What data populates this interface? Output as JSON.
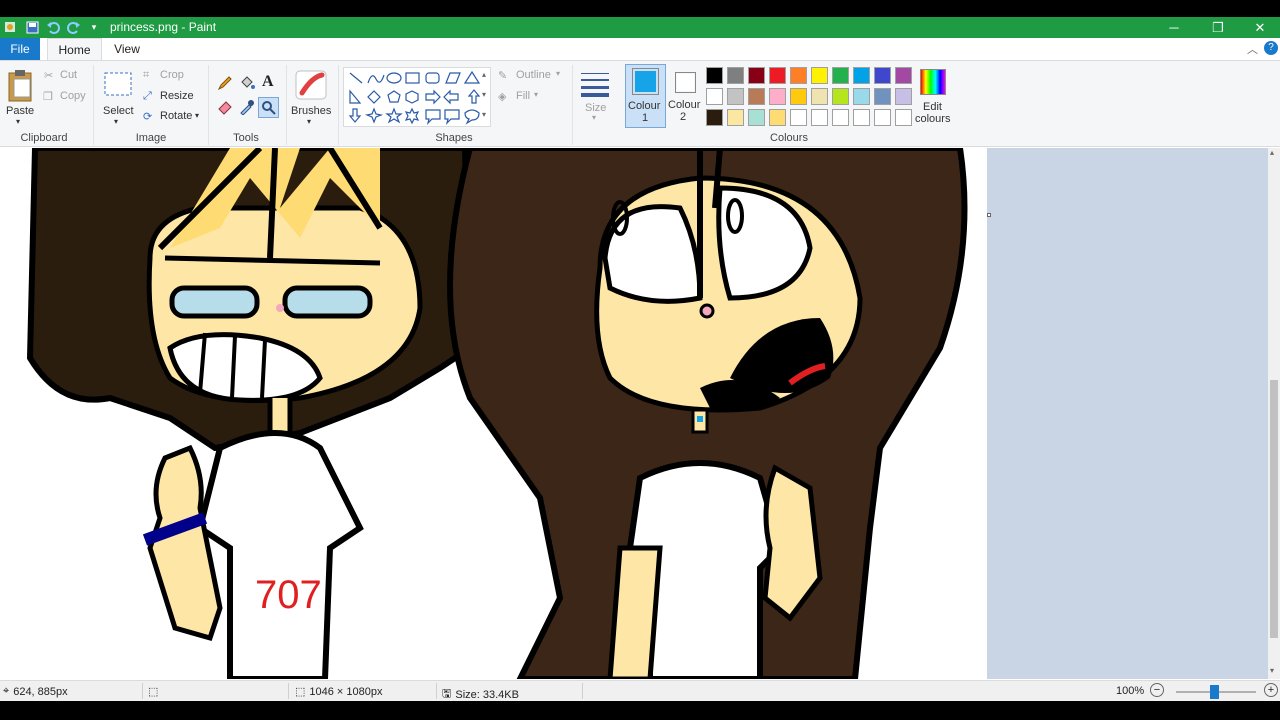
{
  "window": {
    "title": "princess.png - Paint"
  },
  "tabs": {
    "file": "File",
    "home": "Home",
    "view": "View"
  },
  "clipboard": {
    "paste": "Paste",
    "cut": "Cut",
    "copy": "Copy",
    "label": "Clipboard"
  },
  "image": {
    "select": "Select",
    "crop": "Crop",
    "resize": "Resize",
    "rotate": "Rotate",
    "label": "Image"
  },
  "tools": {
    "label": "Tools",
    "text_glyph": "A"
  },
  "brushes": {
    "label": "Brushes"
  },
  "shapes": {
    "outline": "Outline",
    "fill": "Fill",
    "label": "Shapes"
  },
  "size": {
    "label": "Size"
  },
  "colours": {
    "colour1_label": "Colour",
    "colour1_num": "1",
    "colour2_label": "Colour",
    "colour2_num": "2",
    "edit_label": "Edit",
    "edit_label2": "colours",
    "label": "Colours",
    "colour1": "#16a3e8",
    "colour2": "#ffffff",
    "palette_row1": [
      "#000000",
      "#7f7f7f",
      "#880015",
      "#ed1c24",
      "#ff7f27",
      "#fff200",
      "#22b14c",
      "#00a2e8",
      "#3f48cc",
      "#a349a4"
    ],
    "palette_row2": [
      "#ffffff",
      "#c3c3c3",
      "#b97a57",
      "#ffaec9",
      "#ffc90e",
      "#efe4b0",
      "#b5e61d",
      "#99d9ea",
      "#7092be",
      "#c8bfe7"
    ],
    "palette_row3": [
      "#2b1d0e",
      "#fbe6a2",
      "#a8e0d6",
      "#ffdc73",
      "#ffffff",
      "#ffffff",
      "#ffffff",
      "#ffffff",
      "#ffffff",
      "#ffffff"
    ]
  },
  "canvas_art": {
    "shirt_text": "707"
  },
  "status": {
    "cursor_pos": "624, 885px",
    "image_dims": "1046 × 1080px",
    "file_size": "Size: 33.4KB",
    "zoom": "100%"
  }
}
